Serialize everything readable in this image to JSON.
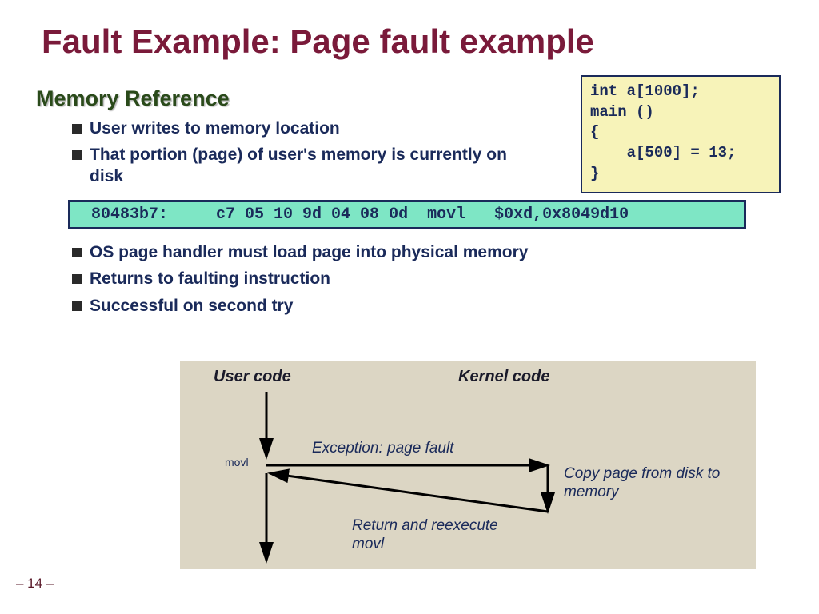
{
  "title": "Fault Example: Page fault example",
  "section": "Memory Reference",
  "bullets_upper": [
    "User writes to memory location",
    "That portion (page) of user's memory is currently on disk"
  ],
  "bullets_lower": [
    "OS page handler must load page into physical memory",
    "Returns to faulting instruction",
    "Successful on second try"
  ],
  "code": {
    "line1": "int a[1000];",
    "line2": "main ()",
    "line3": "{",
    "line4": "    a[500] = 13;",
    "line5": "}"
  },
  "asm": " 80483b7:     c7 05 10 9d 04 08 0d  movl   $0xd,0x8049d10",
  "diagram": {
    "user_code": "User code",
    "kernel_code": "Kernel code",
    "movl": "movl",
    "exception": "Exception: page fault",
    "copy": "Copy page from disk to memory",
    "return": "Return and reexecute movl"
  },
  "page_number": "– 14 –"
}
